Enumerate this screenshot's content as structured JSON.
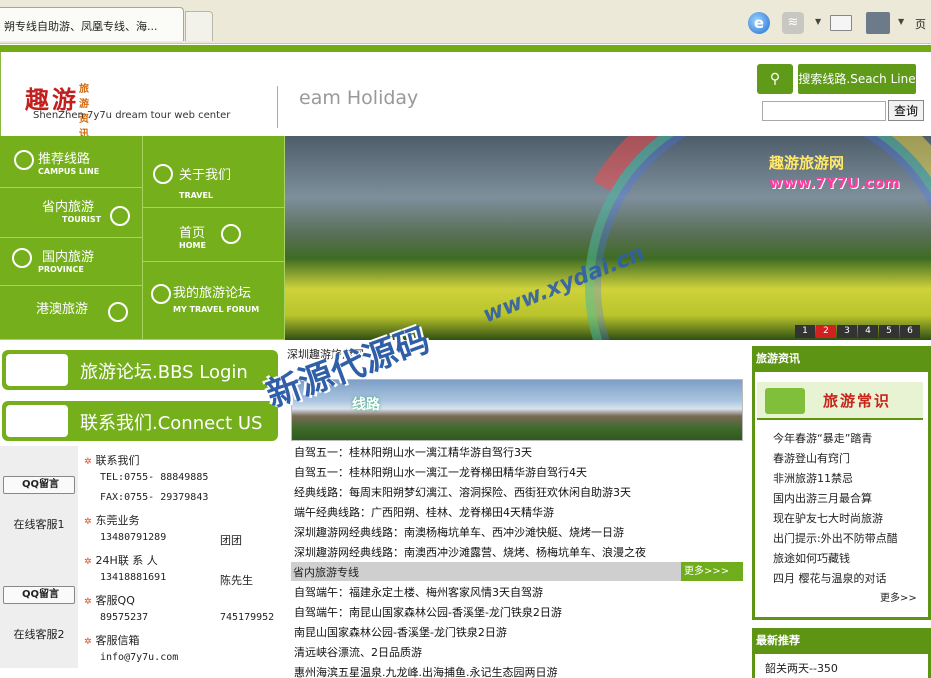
{
  "browser": {
    "tab_title": "朔专线自助游、凤凰专线、海...",
    "page_menu": "页"
  },
  "header": {
    "logo_main_1": "趣游",
    "logo_main_2": "旅游资讯网",
    "logo_sub": "ShenZhen 7y7u dream tour web center",
    "slogan": "eam Holiday",
    "search_title": "搜索线路.Seach Line",
    "search_button": "查询",
    "search_value": ""
  },
  "nav": [
    {
      "label": "推荐线路",
      "en": "CAMPUS LINE"
    },
    {
      "label": "关于我们",
      "en": "TRAVEL"
    },
    {
      "label": "省内旅游",
      "en": "TOURIST"
    },
    {
      "label": "首页",
      "en": "HOME"
    },
    {
      "label": "国内旅游",
      "en": "PROVINCE"
    },
    {
      "label": "港澳旅游",
      "en": ""
    },
    {
      "label": "我的旅游论坛",
      "en": "MY TRAVEL FORUM"
    }
  ],
  "banner": {
    "brand": "趣游旅游网",
    "url": "www.7Y7U.com",
    "pages": [
      "1",
      "2",
      "3",
      "4",
      "5",
      "6"
    ],
    "active_page": "2"
  },
  "left": {
    "bbs_title": "旅游论坛.BBS Login",
    "contact_title": "联系我们.Connect US",
    "qq_button": "QQ留言",
    "service1": "在线客服1",
    "service2": "在线客服2",
    "rows": {
      "contact": "联系我们",
      "tel": "TEL:0755-  88849885",
      "fax": "FAX:0755-  29379843",
      "dongguan": "东莞业务",
      "dg_phone": "13480791289",
      "dg_name": "团团",
      "h24": "24H联 系 人",
      "h24_phone": "13418881691",
      "h24_name": "陈先生",
      "qq": "客服QQ",
      "qq1": "89575237",
      "qq2": "745179952",
      "email": "客服信箱",
      "email_addr": "info@7y7u.com"
    }
  },
  "center": {
    "news_head": "深圳趣游旅游网",
    "landscape_label": "线路",
    "links": [
      "自驾五一：桂林阳朔山水一漓江精华游自驾行3天",
      "自驾五一：桂林阳朔山水一漓江一龙脊梯田精华游自驾行4天",
      "经典线路：每周末阳朔梦幻漓江、溶洞探险、西街狂欢休闲自助游3天",
      "端午经典线路：广西阳朔、桂林、龙脊梯田4天精华游",
      "深圳趣游网经典线路：南澳杨梅坑单车、西冲沙滩快艇、烧烤一日游",
      "深圳趣游网经典线路：南澳西冲沙滩露营、烧烤、杨梅坑单车、浪漫之夜"
    ],
    "section_title": "省内旅游专线",
    "section_more": "更多>>>",
    "links2": [
      "自驾端午：福建永定土楼、梅州客家风情3天自驾游",
      "自驾端午：南昆山国家森林公园-香溪堡-龙门铁泉2日游",
      "南昆山国家森林公园-香溪堡-龙门铁泉2日游",
      "清远峡谷漂流、2日品质游",
      "惠州海滨五星温泉.九龙峰.出海捕鱼.永记生态园两日游"
    ]
  },
  "right": {
    "news_title": "旅游资讯",
    "common_title": "旅游常识",
    "items": [
      "今年春游“暴走”踏青",
      "春游登山有窍门",
      "非洲旅游11禁忌",
      "国内出游三月最合算",
      "现在驴友七大时尚旅游",
      "出门提示:外出不防带点醋",
      "旅途如何巧藏钱",
      "四月 樱花与温泉的对话"
    ],
    "more": "更多>>",
    "recommend_title": "最新推荐",
    "recommend_first": "韶关两天--350"
  },
  "watermark": {
    "site": "www.xydai.cn",
    "name": "新源代源码"
  }
}
